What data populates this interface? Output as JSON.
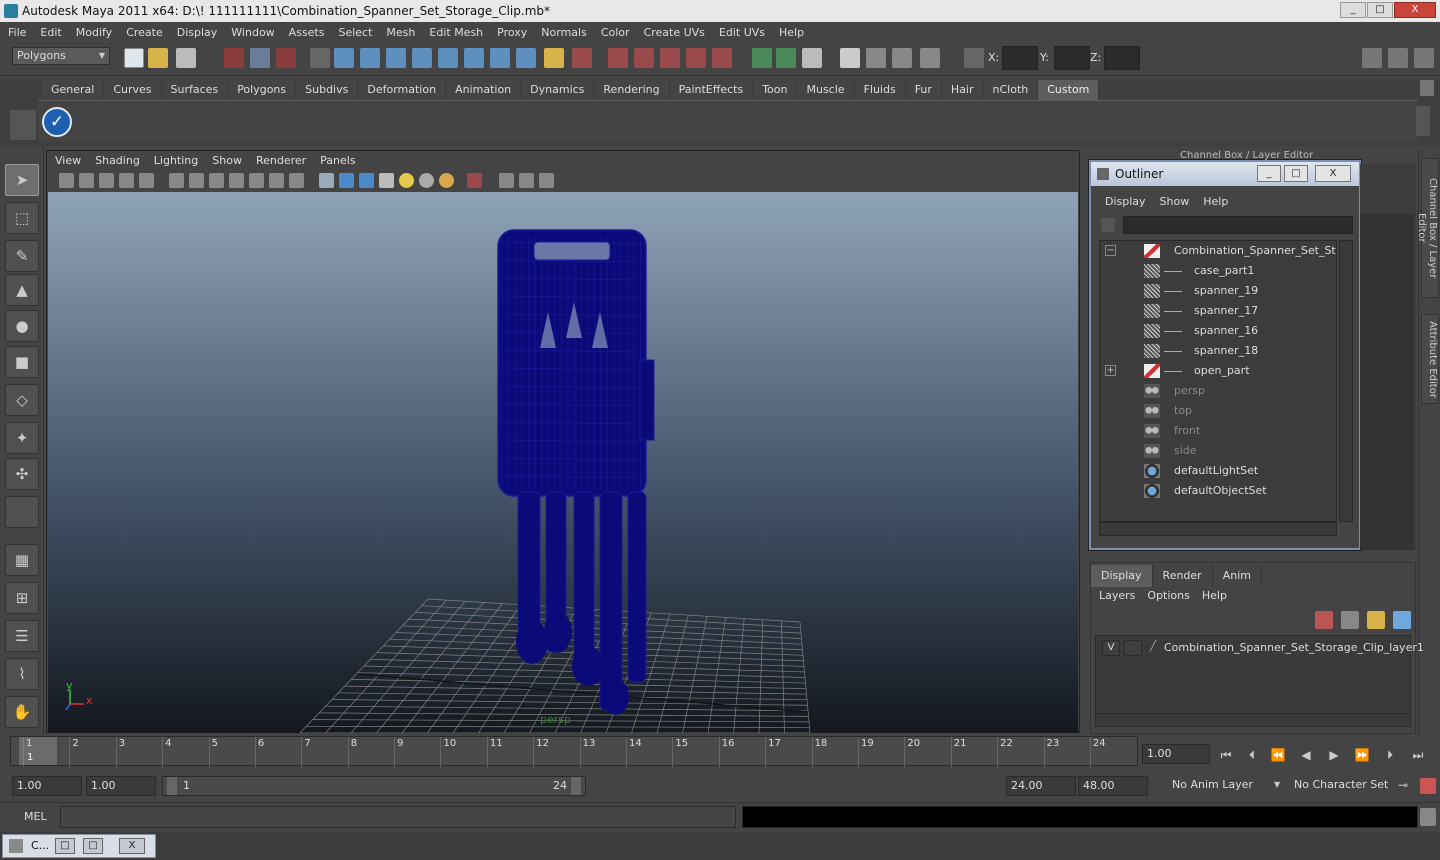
{
  "window": {
    "title": "Autodesk Maya 2011 x64: D:\\! 111111111\\Combination_Spanner_Set_Storage_Clip.mb*",
    "min": "_",
    "max": "□",
    "close": "X"
  },
  "menu": [
    "File",
    "Edit",
    "Modify",
    "Create",
    "Display",
    "Window",
    "Assets",
    "Select",
    "Mesh",
    "Edit Mesh",
    "Proxy",
    "Normals",
    "Color",
    "Create UVs",
    "Edit UVs",
    "Help"
  ],
  "status": {
    "mode": "Polygons",
    "x_label": "X:",
    "y_label": "Y:",
    "z_label": "Z:"
  },
  "shelf": {
    "tabs": [
      "General",
      "Curves",
      "Surfaces",
      "Polygons",
      "Subdivs",
      "Deformation",
      "Animation",
      "Dynamics",
      "Rendering",
      "PaintEffects",
      "Toon",
      "Muscle",
      "Fluids",
      "Fur",
      "Hair",
      "nCloth",
      "Custom"
    ],
    "active": "Custom"
  },
  "panel": {
    "menu": [
      "View",
      "Shading",
      "Lighting",
      "Show",
      "Renderer",
      "Panels"
    ],
    "axis_x": "x",
    "axis_y": "y",
    "camera": "persp"
  },
  "outliner": {
    "title": "Outliner",
    "menu": [
      "Display",
      "Show",
      "Help"
    ],
    "items": [
      {
        "label": "Combination_Spanner_Set_Storag",
        "expand": "−",
        "indent": 0,
        "icon": "group",
        "dim": false
      },
      {
        "label": "case_part1",
        "expand": "",
        "indent": 1,
        "icon": "mesh",
        "dim": false
      },
      {
        "label": "spanner_19",
        "expand": "",
        "indent": 1,
        "icon": "mesh",
        "dim": false
      },
      {
        "label": "spanner_17",
        "expand": "",
        "indent": 1,
        "icon": "mesh",
        "dim": false
      },
      {
        "label": "spanner_16",
        "expand": "",
        "indent": 1,
        "icon": "mesh",
        "dim": false
      },
      {
        "label": "spanner_18",
        "expand": "",
        "indent": 1,
        "icon": "mesh",
        "dim": false
      },
      {
        "label": "open_part",
        "expand": "+",
        "indent": 1,
        "icon": "group",
        "dim": false
      },
      {
        "label": "persp",
        "expand": "",
        "indent": 0,
        "icon": "cam",
        "dim": true
      },
      {
        "label": "top",
        "expand": "",
        "indent": 0,
        "icon": "cam",
        "dim": true
      },
      {
        "label": "front",
        "expand": "",
        "indent": 0,
        "icon": "cam",
        "dim": true
      },
      {
        "label": "side",
        "expand": "",
        "indent": 0,
        "icon": "cam",
        "dim": true
      },
      {
        "label": "defaultLightSet",
        "expand": "",
        "indent": 0,
        "icon": "set",
        "dim": false
      },
      {
        "label": "defaultObjectSet",
        "expand": "",
        "indent": 0,
        "icon": "set",
        "dim": false
      }
    ]
  },
  "channel": {
    "header": "Channel Box / Layer Editor",
    "tab_channel": "Channel Box / Layer Editor",
    "tab_attr": "Attribute Editor"
  },
  "layers": {
    "tabs": [
      "Display",
      "Render",
      "Anim"
    ],
    "active": "Display",
    "menu": [
      "Layers",
      "Options",
      "Help"
    ],
    "rows": [
      {
        "visible": "V",
        "name": "Combination_Spanner_Set_Storage_Clip_layer1"
      }
    ]
  },
  "timeline": {
    "ticks": [
      "1",
      "2",
      "3",
      "4",
      "5",
      "6",
      "7",
      "8",
      "9",
      "10",
      "11",
      "12",
      "13",
      "14",
      "15",
      "16",
      "17",
      "18",
      "19",
      "20",
      "21",
      "22",
      "23",
      "24"
    ],
    "current": "1",
    "current_field": "1.00"
  },
  "range": {
    "start": "1.00",
    "playstart": "1.00",
    "slider_start": "1",
    "slider_end": "24",
    "playend": "24.00",
    "end": "48.00",
    "anim_layer": "No Anim Layer",
    "char_set": "No Character Set"
  },
  "mel": {
    "label": "MEL"
  },
  "taskbar": {
    "label": "C..."
  },
  "colors": {
    "wire": "#0a0a78",
    "accent": "#1e5fb0"
  }
}
